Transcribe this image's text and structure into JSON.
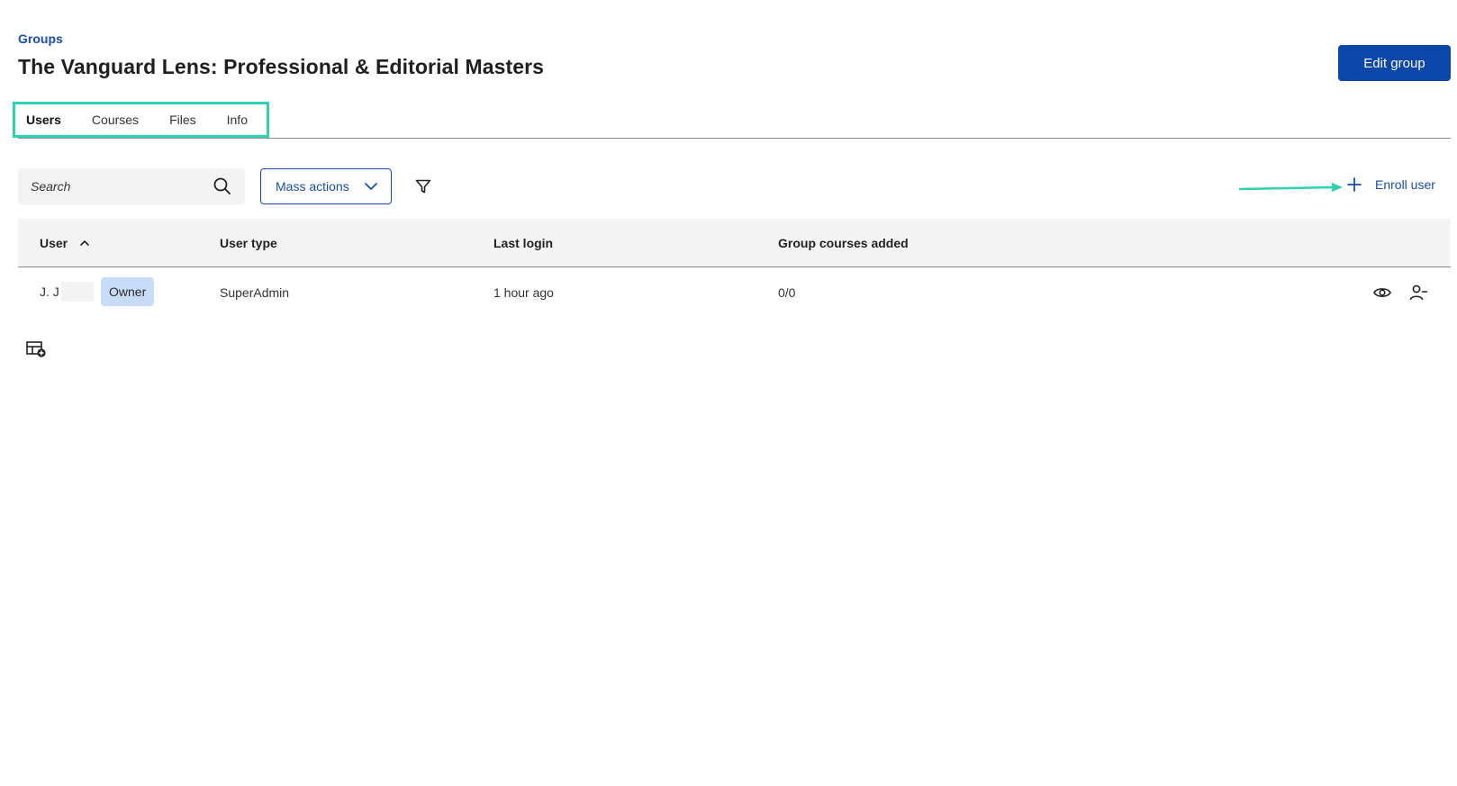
{
  "breadcrumb": {
    "label": "Groups"
  },
  "page": {
    "title": "The Vanguard Lens: Professional & Editorial Masters"
  },
  "header": {
    "edit_label": "Edit group"
  },
  "tabs": [
    {
      "label": "Users",
      "active": true
    },
    {
      "label": "Courses",
      "active": false
    },
    {
      "label": "Files",
      "active": false
    },
    {
      "label": "Info",
      "active": false
    }
  ],
  "toolbar": {
    "search_placeholder": "Search",
    "mass_actions_label": "Mass actions",
    "enroll_label": "Enroll user"
  },
  "table": {
    "columns": [
      "User",
      "User type",
      "Last login",
      "Group courses added"
    ],
    "rows": [
      {
        "user": "J. J",
        "badge": "Owner",
        "user_type": "SuperAdmin",
        "last_login": "1 hour ago",
        "courses_added": "0/0"
      }
    ]
  },
  "colors": {
    "accent": "#0b47a8",
    "annotation": "#2ed1b0",
    "badge_bg": "#c9dcf7"
  },
  "icons": [
    "search-icon",
    "chevron-down-icon",
    "filter-icon",
    "plus-icon",
    "sort-up-icon",
    "eye-icon",
    "remove-user-icon",
    "table-add-icon",
    "arrow-annotation"
  ]
}
